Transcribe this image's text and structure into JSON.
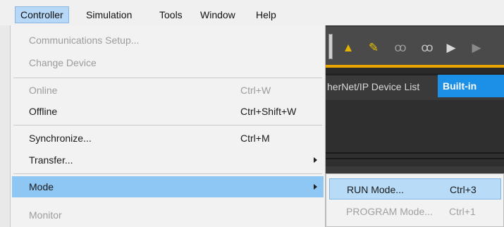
{
  "menubar": {
    "items": [
      {
        "label": "Controller"
      },
      {
        "label": "Simulation"
      },
      {
        "label": "Tools"
      },
      {
        "label": "Window"
      },
      {
        "label": "Help"
      }
    ]
  },
  "background": {
    "tab_ethernet": "herNet/IP Device List",
    "tab_builtin": "Built-in"
  },
  "toolbar_icons": [
    "warning-icon",
    "pencil-warning-icon",
    "glasses-icon",
    "glasses-x-icon",
    "run-icon",
    "run-icon-2"
  ],
  "controller_menu": {
    "items": [
      {
        "label": "Communications Setup...",
        "shortcut": "",
        "disabled": true
      },
      {
        "label": "Change Device",
        "shortcut": "",
        "disabled": true
      },
      {
        "label": "Online",
        "shortcut": "Ctrl+W",
        "disabled": true
      },
      {
        "label": "Offline",
        "shortcut": "Ctrl+Shift+W",
        "disabled": false
      },
      {
        "label": "Synchronize...",
        "shortcut": "Ctrl+M",
        "disabled": false
      },
      {
        "label": "Transfer...",
        "shortcut": "",
        "disabled": false,
        "submenu": true
      },
      {
        "label": "Mode",
        "shortcut": "",
        "disabled": false,
        "submenu": true,
        "highlighted": true
      },
      {
        "label": "Monitor",
        "shortcut": "",
        "disabled": true
      }
    ]
  },
  "mode_submenu": {
    "items": [
      {
        "label": "RUN Mode...",
        "shortcut": "Ctrl+3",
        "disabled": false,
        "highlighted": true
      },
      {
        "label": "PROGRAM Mode...",
        "shortcut": "Ctrl+1",
        "disabled": true
      }
    ]
  },
  "colors": {
    "menu_highlight": "#8ec7f3",
    "builtin_tab": "#1c8fe6",
    "toolbar_accent": "#e9a400"
  }
}
